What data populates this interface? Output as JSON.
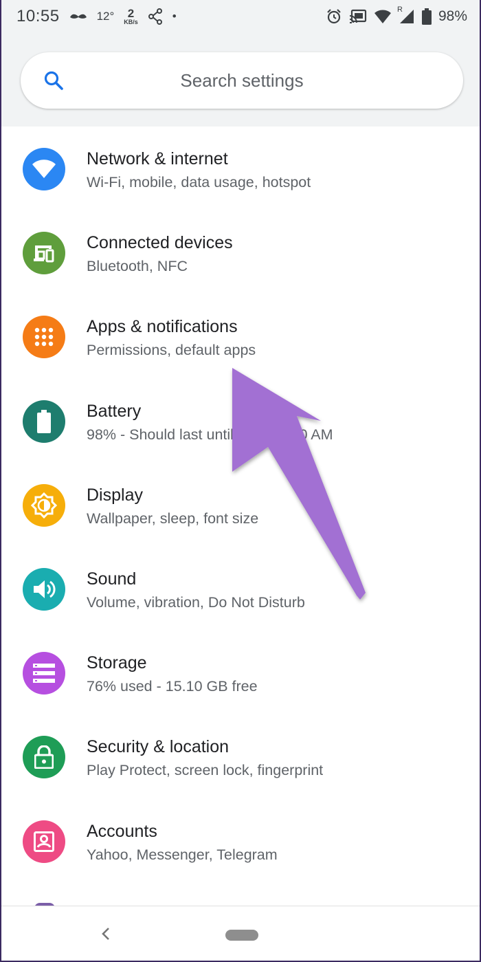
{
  "status_bar": {
    "time": "10:55",
    "temperature": "12°",
    "net_speed_value": "2",
    "net_speed_unit": "KB/s",
    "dot": "•",
    "battery_percent": "98%",
    "signal_roaming": "R",
    "icons": [
      "mustache-icon",
      "share-icon",
      "alarm-icon",
      "cast-icon",
      "wifi-icon",
      "signal-icon",
      "battery-icon"
    ]
  },
  "search": {
    "placeholder": "Search settings"
  },
  "settings": [
    {
      "title": "Network & internet",
      "subtitle": "Wi-Fi, mobile, data usage, hotspot",
      "color": "#2b87f3",
      "icon": "wifi-icon"
    },
    {
      "title": "Connected devices",
      "subtitle": "Bluetooth, NFC",
      "color": "#5f9e3c",
      "icon": "devices-icon"
    },
    {
      "title": "Apps & notifications",
      "subtitle": "Permissions, default apps",
      "color": "#f57c16",
      "icon": "apps-grid-icon"
    },
    {
      "title": "Battery",
      "subtitle": "98% - Should last until about 3:00 AM",
      "color": "#1e7d6e",
      "icon": "battery-icon"
    },
    {
      "title": "Display",
      "subtitle": "Wallpaper, sleep, font size",
      "color": "#f6ae0a",
      "icon": "brightness-icon"
    },
    {
      "title": "Sound",
      "subtitle": "Volume, vibration, Do Not Disturb",
      "color": "#1aadb0",
      "icon": "volume-icon"
    },
    {
      "title": "Storage",
      "subtitle": "76% used - 15.10 GB free",
      "color": "#b64fe0",
      "icon": "storage-icon"
    },
    {
      "title": "Security & location",
      "subtitle": "Play Protect, screen lock, fingerprint",
      "color": "#1e9d56",
      "icon": "lock-icon"
    },
    {
      "title": "Accounts",
      "subtitle": "Yahoo, Messenger, Telegram",
      "color": "#ee4b84",
      "icon": "account-icon"
    }
  ],
  "annotation": {
    "arrow_color": "#a26fd3",
    "icon": "arrow-pointer-icon"
  },
  "navbar": {
    "back": "‹"
  }
}
